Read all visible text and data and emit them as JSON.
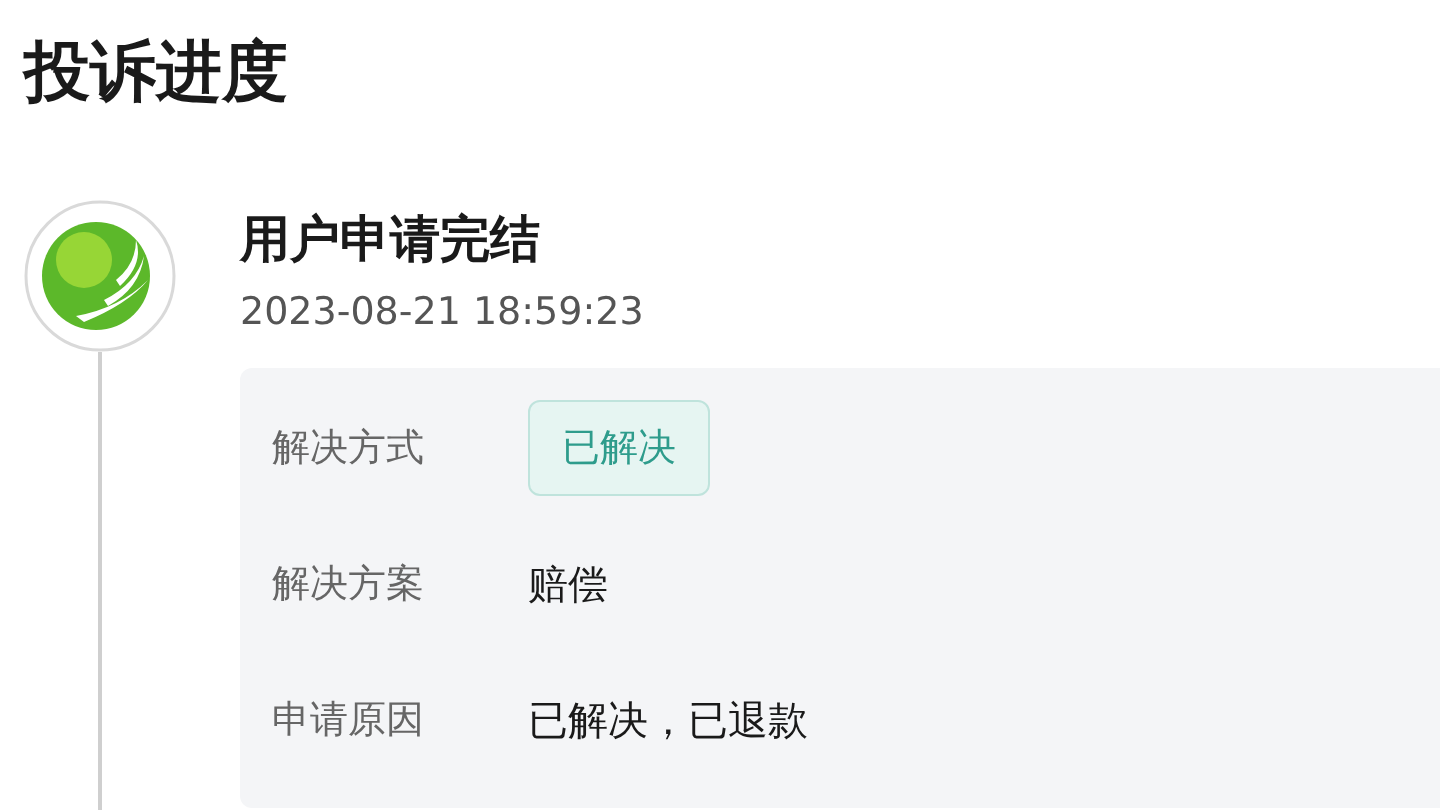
{
  "page": {
    "title": "投诉进度"
  },
  "timeline": [
    {
      "title": "用户申请完结",
      "time": "2023-08-21 18:59:23",
      "details": [
        {
          "label": "解决方式",
          "value": "已解决",
          "kind": "badge"
        },
        {
          "label": "解决方案",
          "value": "赔偿",
          "kind": "text"
        },
        {
          "label": "申请原因",
          "value": "已解决，已退款",
          "kind": "text"
        }
      ]
    }
  ]
}
